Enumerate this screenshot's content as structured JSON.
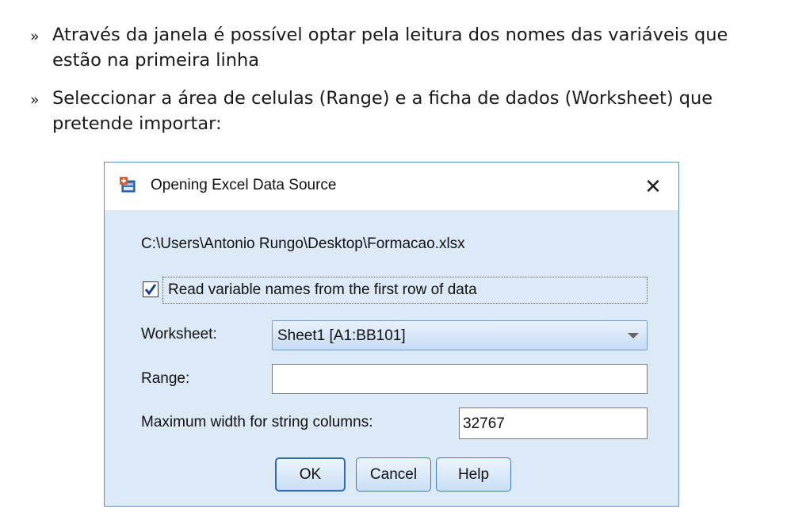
{
  "bullets": [
    {
      "marker": "»",
      "lines": [
        "Através da janela é possível optar pela leitura dos nomes das variáveis que",
        "estão na primeira linha"
      ]
    },
    {
      "marker": "»",
      "lines": [
        "Seleccionar a área de celulas (Range) e a ficha de dados (Worksheet) que",
        "pretende importar:"
      ]
    }
  ],
  "dialog": {
    "title": "Opening Excel Data Source",
    "close_glyph": "✕",
    "file_path": "C:\\Users\\Antonio Rungo\\Desktop\\Formacao.xlsx",
    "read_names": {
      "checked": true,
      "label": "Read variable names from the first row of data"
    },
    "worksheet": {
      "label": "Worksheet:",
      "value": "Sheet1 [A1:BB101]"
    },
    "range": {
      "label": "Range:",
      "value": ""
    },
    "max_width": {
      "label": "Maximum width for string columns:",
      "value": "32767"
    },
    "buttons": {
      "ok": "OK",
      "cancel": "Cancel",
      "help": "Help"
    }
  },
  "icons": {
    "app": "spss-data-icon",
    "close": "close-icon",
    "check": "checkmark-icon",
    "dropdown": "chevron-down-icon"
  },
  "colors": {
    "dialog_bg": "#dce9f7",
    "border": "#5f8ec4",
    "button_border": "#3d79bf"
  }
}
